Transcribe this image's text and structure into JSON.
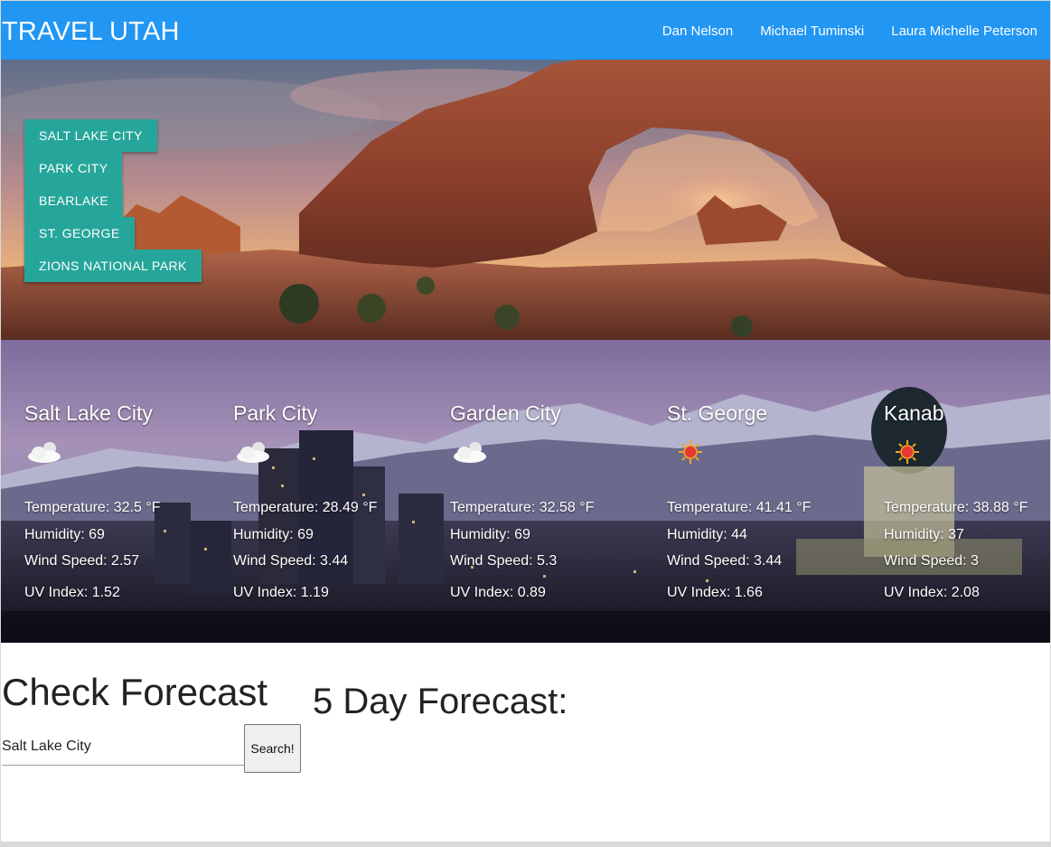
{
  "navbar": {
    "brand": "TRAVEL UTAH",
    "links": [
      "Dan Nelson",
      "Michael Tuminski",
      "Laura Michelle Peterson"
    ],
    "color": "#2196f3"
  },
  "cities_menu": [
    "SALT LAKE CITY",
    "PARK CITY",
    "BEARLAKE",
    "ST. GEORGE",
    "ZIONS NATIONAL PARK"
  ],
  "weather": [
    {
      "city": "Salt Lake City",
      "icon": "partly-cloudy-icon",
      "temperature": "Temperature: 32.5 °F",
      "humidity": "Humidity: 69",
      "wind": "Wind Speed: 2.57",
      "uv": "UV Index: 1.52"
    },
    {
      "city": "Park City",
      "icon": "partly-cloudy-icon",
      "temperature": "Temperature: 28.49 °F",
      "humidity": "Humidity: 69",
      "wind": "Wind Speed: 3.44",
      "uv": "UV Index: 1.19"
    },
    {
      "city": "Garden City",
      "icon": "partly-cloudy-icon",
      "temperature": "Temperature: 32.58 °F",
      "humidity": "Humidity: 69",
      "wind": "Wind Speed: 5.3",
      "uv": "UV Index: 0.89"
    },
    {
      "city": "St. George",
      "icon": "sun-icon",
      "temperature": "Temperature: 41.41 °F",
      "humidity": "Humidity: 44",
      "wind": "Wind Speed: 3.44",
      "uv": "UV Index: 1.66"
    },
    {
      "city": "Kanab",
      "icon": "sun-icon",
      "temperature": "Temperature: 38.88 °F",
      "humidity": "Humidity: 37",
      "wind": "Wind Speed: 3",
      "uv": "UV Index: 2.08"
    }
  ],
  "forecast": {
    "check_title": "Check Forecast",
    "search_value": "Salt Lake City",
    "search_button": "Search!",
    "five_day_title": "5 Day Forecast:"
  },
  "colors": {
    "accent_button": "#26a69a"
  }
}
